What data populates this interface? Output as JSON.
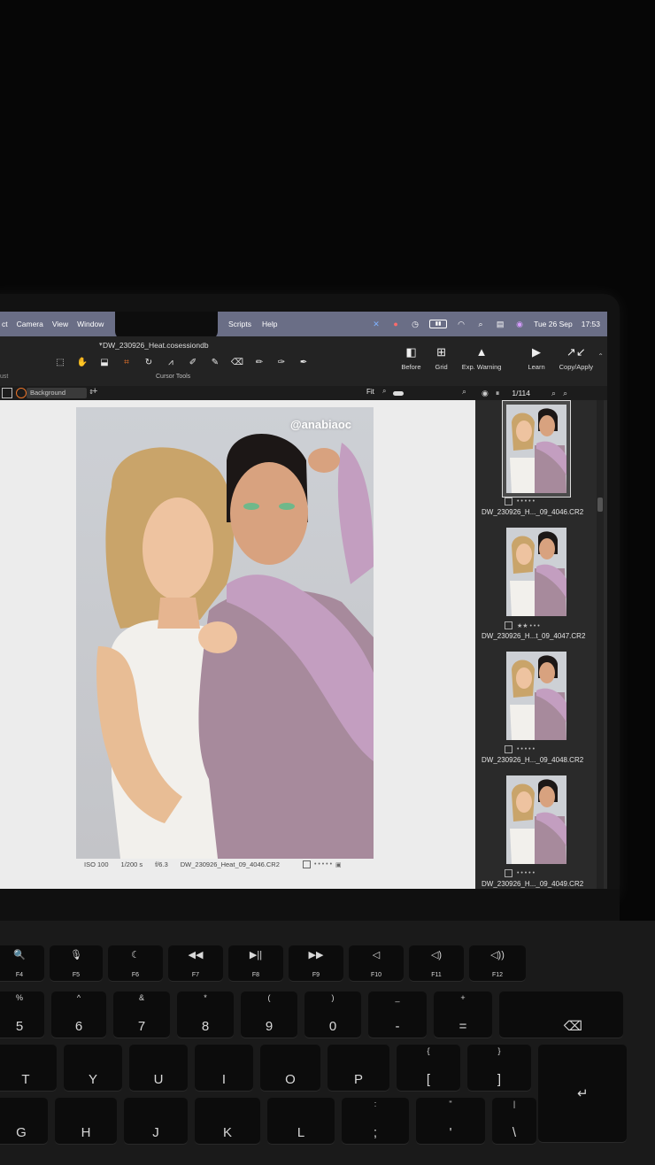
{
  "menubar": {
    "left_items": [
      "ct",
      "Camera",
      "View",
      "Window"
    ],
    "mid_items": [
      "Scripts",
      "Help"
    ],
    "date": "Tue 26 Sep",
    "time": "17:53",
    "bar_color": "#6a6e86"
  },
  "toolbar": {
    "doc_title": "DW_230926_Heat.cosessiondb",
    "cursor_tools_label": "Cursor Tools",
    "adjust_label": "ust",
    "right_tools": [
      {
        "label": "Before",
        "icon": "before-after-icon"
      },
      {
        "label": "Grid",
        "icon": "grid-icon"
      },
      {
        "label": "Exp. Warning",
        "icon": "warning-icon"
      },
      {
        "label": "Learn",
        "icon": "play-icon"
      },
      {
        "label": "Copy/Apply",
        "icon": "copy-apply-arrows-icon"
      }
    ],
    "accent_color": "#e8742a"
  },
  "subbar": {
    "layer": "Background",
    "fit_label": "Fit",
    "counter": "1/114"
  },
  "viewer": {
    "watermark": "@anabiaoc",
    "meta": {
      "iso": "ISO 100",
      "shutter": "1/200 s",
      "aperture": "f/6.3",
      "filename": "DW_230926_Heat_09_4046.CR2",
      "rating_dots": "• • • • •"
    }
  },
  "browser": {
    "thumbnails": [
      {
        "name": "DW_230926_H..._09_4046.CR2",
        "stars": "• • • • •",
        "selected": true
      },
      {
        "name": "DW_230926_H...t_09_4047.CR2",
        "stars": "★★ • • •",
        "selected": false
      },
      {
        "name": "DW_230926_H..._09_4048.CR2",
        "stars": "• • • • •",
        "selected": false
      },
      {
        "name": "DW_230926_H..._09_4049.CR2",
        "stars": "• • • • •",
        "selected": false
      }
    ]
  },
  "keyboard": {
    "fn_row": [
      {
        "glyph": "🔍",
        "label": "F4"
      },
      {
        "glyph": "🎙",
        "label": "F5"
      },
      {
        "glyph": "☾",
        "label": "F6"
      },
      {
        "glyph": "◀◀",
        "label": "F7"
      },
      {
        "glyph": "▶||",
        "label": "F8"
      },
      {
        "glyph": "▶▶",
        "label": "F9"
      },
      {
        "glyph": "◁",
        "label": "F10"
      },
      {
        "glyph": "◁)",
        "label": "F11"
      },
      {
        "glyph": "◁))",
        "label": "F12"
      }
    ],
    "num_row": [
      {
        "top": "%",
        "bot": "5"
      },
      {
        "top": "^",
        "bot": "6"
      },
      {
        "top": "&",
        "bot": "7"
      },
      {
        "top": "*",
        "bot": "8"
      },
      {
        "top": "(",
        "bot": "9"
      },
      {
        "top": ")",
        "bot": "0"
      },
      {
        "top": "_",
        "bot": "-"
      },
      {
        "top": "+",
        "bot": "="
      },
      {
        "top": "",
        "bot": "⌫"
      }
    ],
    "letter_row": [
      {
        "top": "",
        "bot": "T"
      },
      {
        "top": "",
        "bot": "Y"
      },
      {
        "top": "",
        "bot": "U"
      },
      {
        "top": "",
        "bot": "I"
      },
      {
        "top": "",
        "bot": "O"
      },
      {
        "top": "",
        "bot": "P"
      },
      {
        "top": "{",
        "bot": "["
      },
      {
        "top": "}",
        "bot": "]"
      },
      {
        "top": "",
        "bot": "↵"
      }
    ],
    "home_row": [
      {
        "top": "",
        "bot": "G"
      },
      {
        "top": "",
        "bot": "H"
      },
      {
        "top": "",
        "bot": "J"
      },
      {
        "top": "",
        "bot": "K"
      },
      {
        "top": "",
        "bot": "L"
      },
      {
        "top": ":",
        "bot": ";"
      },
      {
        "top": "\"",
        "bot": "'"
      },
      {
        "top": "|",
        "bot": "\\"
      }
    ]
  }
}
